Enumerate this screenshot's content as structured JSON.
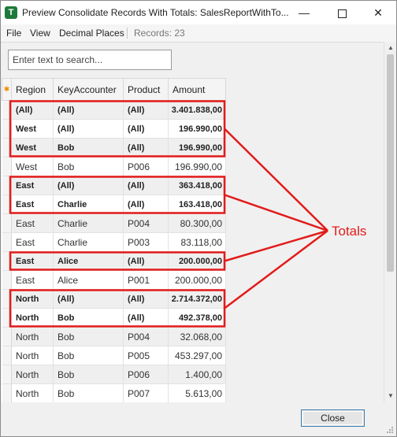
{
  "window": {
    "title": "Preview Consolidate Records With Totals: SalesReportWithTo...",
    "icon_letter": "T"
  },
  "menu": {
    "file": "File",
    "view": "View",
    "decimal": "Decimal Places",
    "records": "Records: 23"
  },
  "search": {
    "placeholder": "Enter text to search..."
  },
  "grid": {
    "indicator": "✱",
    "columns": [
      "Region",
      "KeyAccounter",
      "Product",
      "Amount"
    ],
    "rows": [
      {
        "total": true,
        "cells": [
          "(All)",
          "(All)",
          "(All)",
          "3.401.838,00"
        ]
      },
      {
        "total": true,
        "cells": [
          "West",
          "(All)",
          "(All)",
          "196.990,00"
        ]
      },
      {
        "total": true,
        "cells": [
          "West",
          "Bob",
          "(All)",
          "196.990,00"
        ]
      },
      {
        "total": false,
        "cells": [
          "West",
          "Bob",
          "P006",
          "196.990,00"
        ]
      },
      {
        "total": true,
        "cells": [
          "East",
          "(All)",
          "(All)",
          "363.418,00"
        ]
      },
      {
        "total": true,
        "cells": [
          "East",
          "Charlie",
          "(All)",
          "163.418,00"
        ]
      },
      {
        "total": false,
        "cells": [
          "East",
          "Charlie",
          "P004",
          "80.300,00"
        ]
      },
      {
        "total": false,
        "cells": [
          "East",
          "Charlie",
          "P003",
          "83.118,00"
        ]
      },
      {
        "total": true,
        "cells": [
          "East",
          "Alice",
          "(All)",
          "200.000,00"
        ]
      },
      {
        "total": false,
        "cells": [
          "East",
          "Alice",
          "P001",
          "200.000,00"
        ]
      },
      {
        "total": true,
        "cells": [
          "North",
          "(All)",
          "(All)",
          "2.714.372,00"
        ]
      },
      {
        "total": true,
        "cells": [
          "North",
          "Bob",
          "(All)",
          "492.378,00"
        ]
      },
      {
        "total": false,
        "cells": [
          "North",
          "Bob",
          "P004",
          "32.068,00"
        ]
      },
      {
        "total": false,
        "cells": [
          "North",
          "Bob",
          "P005",
          "453.297,00"
        ]
      },
      {
        "total": false,
        "cells": [
          "North",
          "Bob",
          "P006",
          "1.400,00"
        ]
      },
      {
        "total": false,
        "cells": [
          "North",
          "Bob",
          "P007",
          "5.613,00"
        ]
      }
    ]
  },
  "footer": {
    "close_label": "Close"
  },
  "annotation": {
    "label": "Totals",
    "color": "#e21b1b"
  },
  "colors": {
    "total_row_shade": "#efefef",
    "app_icon": "#1e7a3a",
    "button_border": "#3c7fb1"
  }
}
